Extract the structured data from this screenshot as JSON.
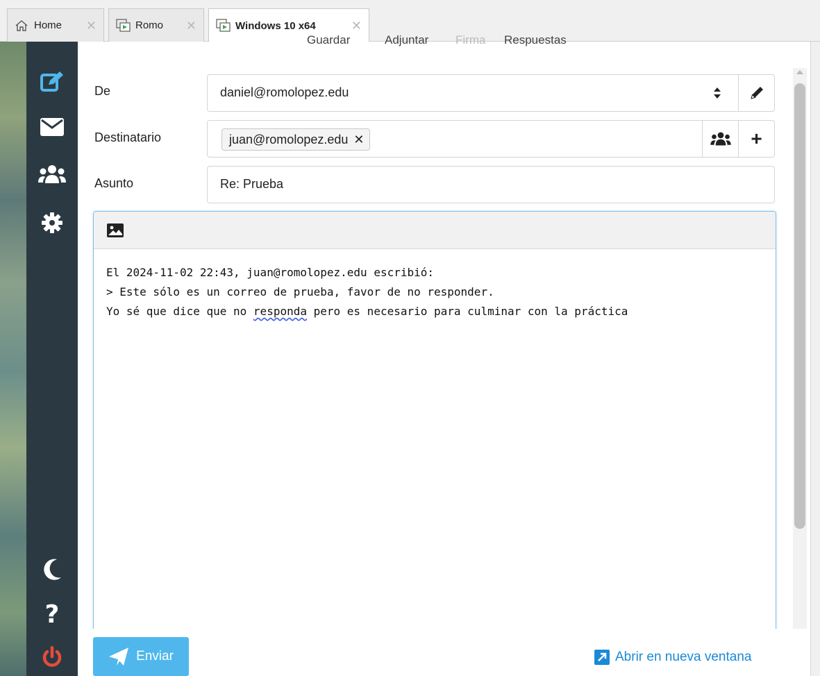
{
  "tabs": [
    {
      "label": "Home",
      "icon": "home-icon",
      "active": false
    },
    {
      "label": "Romo",
      "icon": "vm-icon",
      "active": false
    },
    {
      "label": "Windows 10 x64",
      "icon": "vm-icon",
      "active": true
    }
  ],
  "top_menu": {
    "save": "Guardar",
    "attach": "Adjuntar",
    "signature": "Firma",
    "responses": "Respuestas"
  },
  "sidebar": {
    "items": [
      {
        "name": "compose",
        "icon": "compose-icon",
        "color": "#4fb7ec"
      },
      {
        "name": "mail",
        "icon": "envelope-icon",
        "color": "#ffffff"
      },
      {
        "name": "contacts",
        "icon": "users-icon",
        "color": "#ffffff"
      },
      {
        "name": "settings",
        "icon": "gear-icon",
        "color": "#ffffff"
      }
    ],
    "bottom_items": [
      {
        "name": "dark-mode",
        "icon": "moon-icon",
        "color": "#ffffff"
      },
      {
        "name": "help",
        "icon": "question-icon",
        "color": "#ffffff"
      },
      {
        "name": "logout",
        "icon": "power-icon",
        "color": "#e74c3c"
      }
    ]
  },
  "form": {
    "from_label": "De",
    "from_value": "daniel@romolopez.edu",
    "to_label": "Destinatario",
    "to_recipients": [
      "juan@romolopez.edu"
    ],
    "subject_label": "Asunto",
    "subject_value": "Re: Prueba"
  },
  "editor": {
    "line1": "El 2024-11-02 22:43, juan@romolopez.edu escribió:",
    "line2": "> Este sólo es un correo de prueba, favor de no responder.",
    "line3_before": "Yo sé que dice que no ",
    "line3_misspelled": "responda",
    "line3_after": " pero es necesario para culminar con la práctica"
  },
  "footer": {
    "send_label": "Enviar",
    "open_new_window": "Abrir en nueva ventana"
  },
  "colors": {
    "accent": "#4fb7ec",
    "sidebar_bg": "#2b3a42",
    "link": "#1a8ad6",
    "logout": "#e74c3c"
  }
}
